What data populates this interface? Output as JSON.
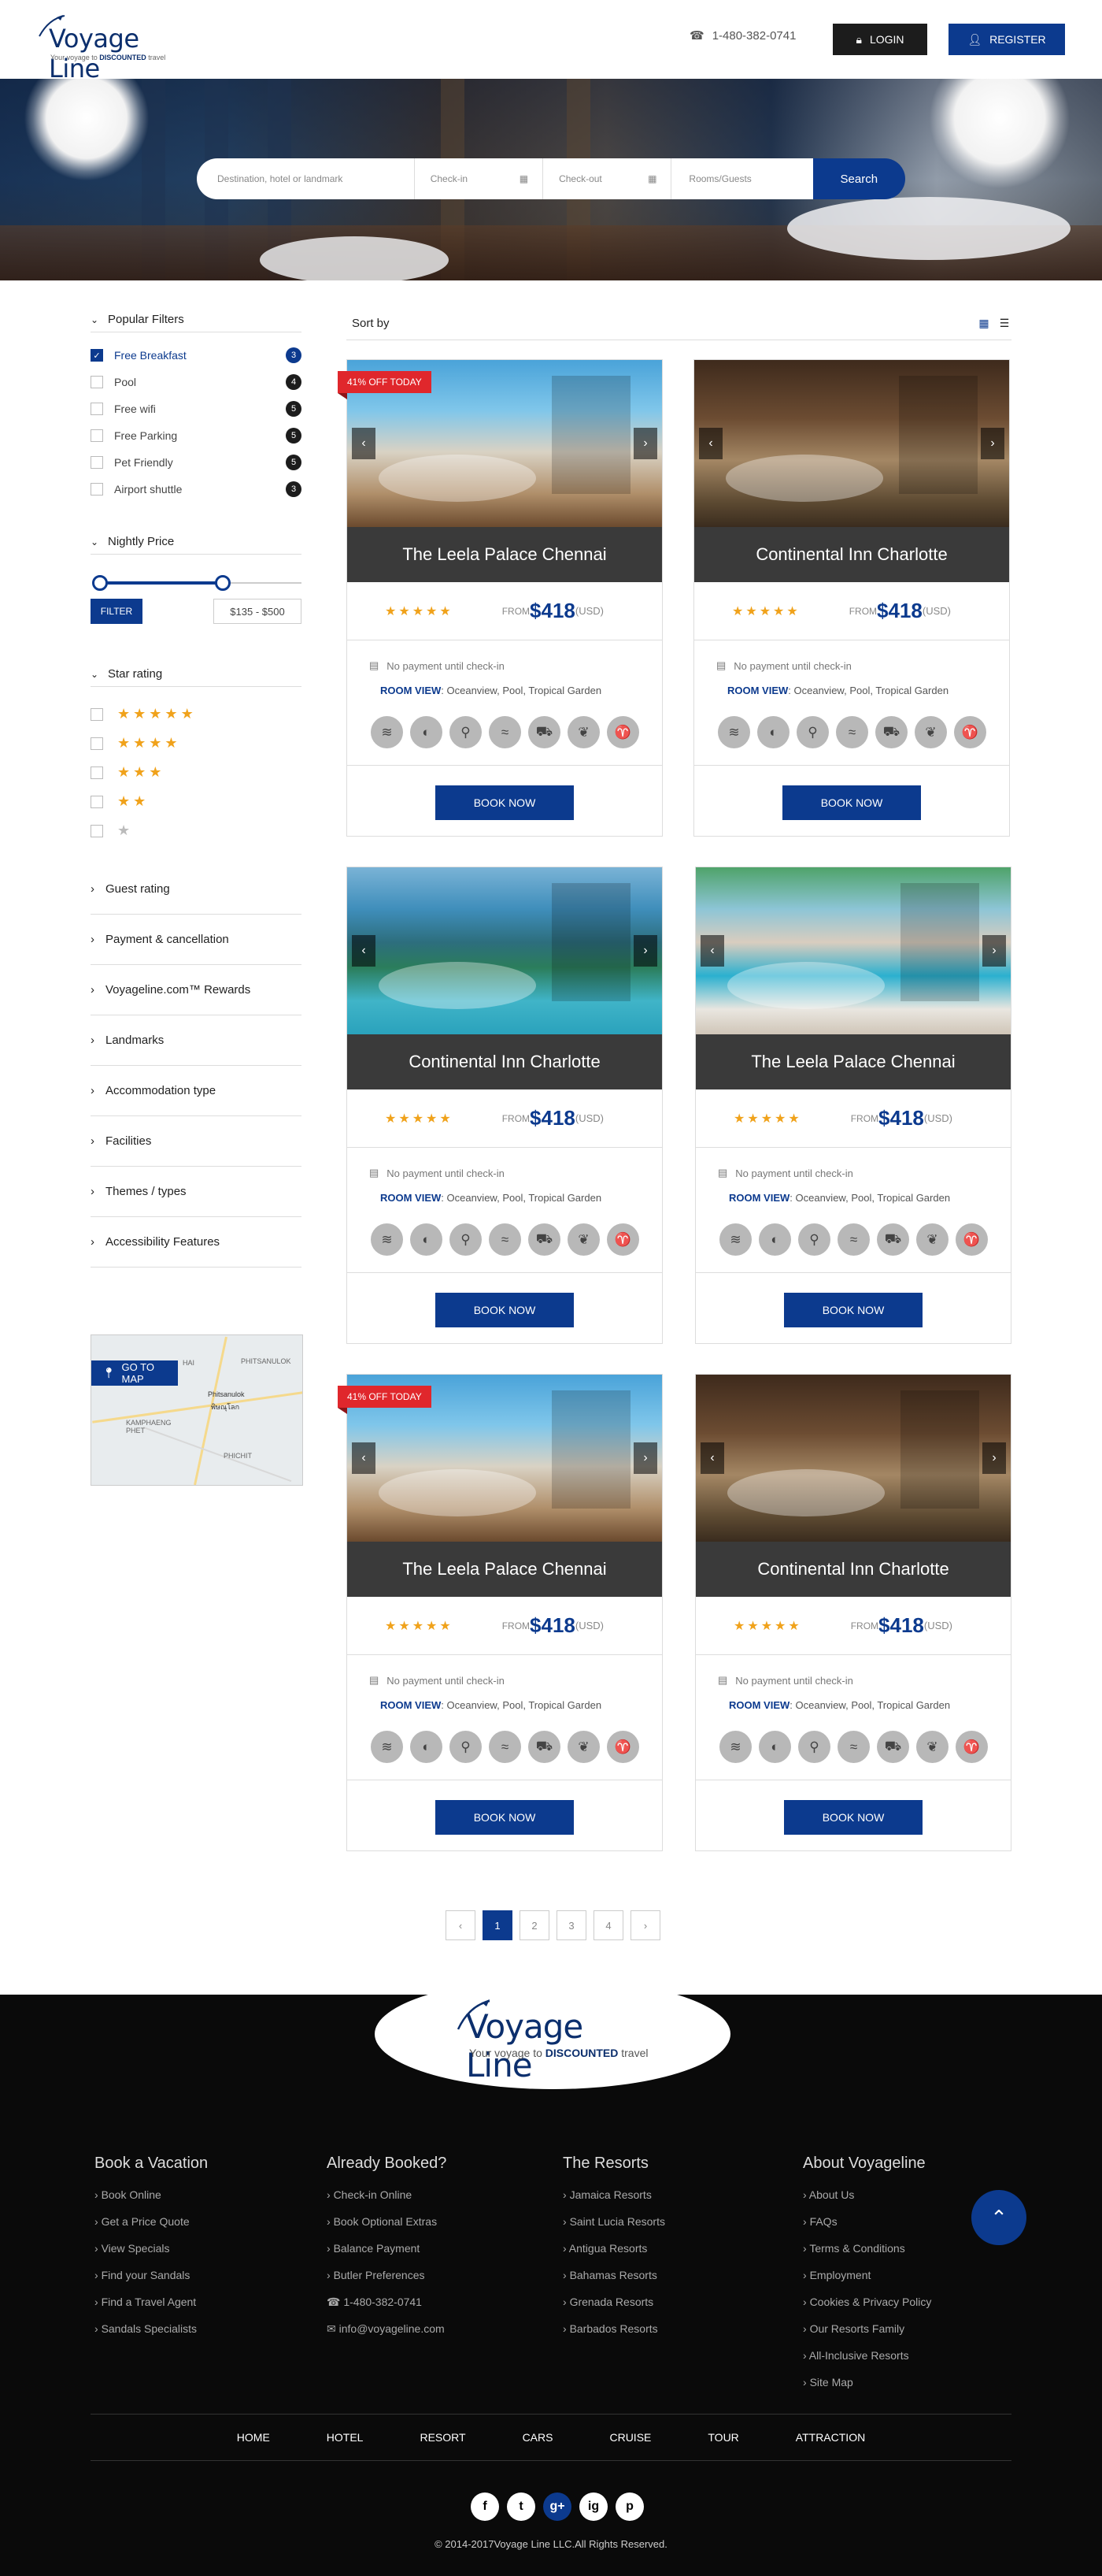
{
  "header": {
    "logo_title": "Voyage Line",
    "logo_tag_pre": "Your voyage to ",
    "logo_tag_bold": "DISCOUNTED",
    "logo_tag_post": " travel",
    "phone": "1-480-382-0741",
    "login": "LOGIN",
    "register": "REGISTER"
  },
  "search": {
    "destination": "Destination, hotel or landmark",
    "checkin": "Check-in",
    "checkout": "Check-out",
    "rooms": "Rooms/Guests",
    "button": "Search"
  },
  "sidebar": {
    "popular_title": "Popular Filters",
    "filters": [
      {
        "label": "Free Breakfast",
        "count": "3",
        "checked": true
      },
      {
        "label": "Pool",
        "count": "4",
        "checked": false
      },
      {
        "label": "Free wifi",
        "count": "5",
        "checked": false
      },
      {
        "label": "Free Parking",
        "count": "5",
        "checked": false
      },
      {
        "label": "Pet Friendly",
        "count": "5",
        "checked": false
      },
      {
        "label": "Airport shuttle",
        "count": "3",
        "checked": false
      }
    ],
    "price_title": "Nightly Price",
    "filter_button": "FILTER",
    "price_range": "$135 - $500",
    "price_fill_fraction": 0.61,
    "star_title": "Star rating",
    "star_options": [
      5,
      4,
      3,
      2,
      1
    ],
    "collapsed": [
      "Guest rating",
      "Payment & cancellation",
      "Voyageline.com™ Rewards",
      "Landmarks",
      "Accommodation type",
      "Facilities",
      "Themes / types",
      "Accessibility Features"
    ],
    "map_button": "GO TO MAP",
    "map_labels": [
      "PHITSANULOK",
      "Phitsanulok",
      "พิษณุโลก",
      "KAMPHAENG PHET",
      "PHICHIT",
      "HAI"
    ]
  },
  "sort": {
    "label": "Sort by"
  },
  "cards": [
    {
      "name": "The Leela Palace Chennai",
      "price": "$418",
      "discount": "41% OFF TODAY",
      "photo": "ph-a"
    },
    {
      "name": "Continental Inn Charlotte",
      "price": "$418",
      "discount": "",
      "photo": "ph-b"
    },
    {
      "name": "Continental Inn Charlotte",
      "price": "$418",
      "discount": "",
      "photo": "ph-c"
    },
    {
      "name": "The Leela Palace Chennai",
      "price": "$418",
      "discount": "",
      "photo": "ph-d"
    },
    {
      "name": "The Leela Palace Chennai",
      "price": "$418",
      "discount": "41% OFF TODAY",
      "photo": "ph-a"
    },
    {
      "name": "Continental Inn Charlotte",
      "price": "$418",
      "discount": "",
      "photo": "ph-b"
    }
  ],
  "card_common": {
    "stars": "★★★★★",
    "from": "FROM",
    "currency": "(USD)",
    "nopay": "No payment until check-in",
    "view_label": "ROOM VIEW",
    "view_text": ": Oceanview, Pool, Tropical Garden",
    "book": "BOOK NOW",
    "amenities": [
      "wifi-icon",
      "food-icon",
      "fitness-icon",
      "pool-icon",
      "car-icon",
      "spa-icon",
      "wine-icon"
    ]
  },
  "pagination": {
    "prev": "‹",
    "pages": [
      "1",
      "2",
      "3",
      "4"
    ],
    "next": "›",
    "current": "1"
  },
  "footer": {
    "logo_title": "Voyage Line",
    "logo_tag_pre": "Your voyage to ",
    "logo_tag_bold": "DISCOUNTED",
    "logo_tag_post": " travel",
    "columns": [
      {
        "title": "Book a Vacation",
        "items": [
          "Book Online",
          "Get a Price Quote",
          "View Specials",
          "Find your Sandals",
          "Find a Travel Agent",
          "Sandals Specialists"
        ]
      },
      {
        "title": "Already Booked?",
        "items": [
          "Check-in Online",
          "Book Optional Extras",
          "Balance Payment",
          "Butler Preferences"
        ],
        "phone": "1-480-382-0741",
        "email": "info@voyageline.com"
      },
      {
        "title": "The Resorts",
        "items": [
          "Jamaica Resorts",
          "Saint Lucia Resorts",
          "Antigua Resorts",
          "Bahamas Resorts",
          "Grenada Resorts",
          "Barbados Resorts"
        ]
      },
      {
        "title": "About Voyageline",
        "items": [
          "About Us",
          "FAQs",
          "Terms & Conditions",
          "Employment",
          "Cookies & Privacy Policy",
          "Our Resorts Family",
          "All-Inclusive Resorts",
          "Site Map"
        ]
      }
    ],
    "nav": [
      "HOME",
      "HOTEL",
      "RESORT",
      "CARS",
      "CRUISE",
      "TOUR",
      "ATTRACTION"
    ],
    "social": [
      "f",
      "t",
      "g+",
      "ig",
      "p"
    ],
    "copyright": "© 2014-2017Voyage Line LLC.All Rights Reserved."
  }
}
